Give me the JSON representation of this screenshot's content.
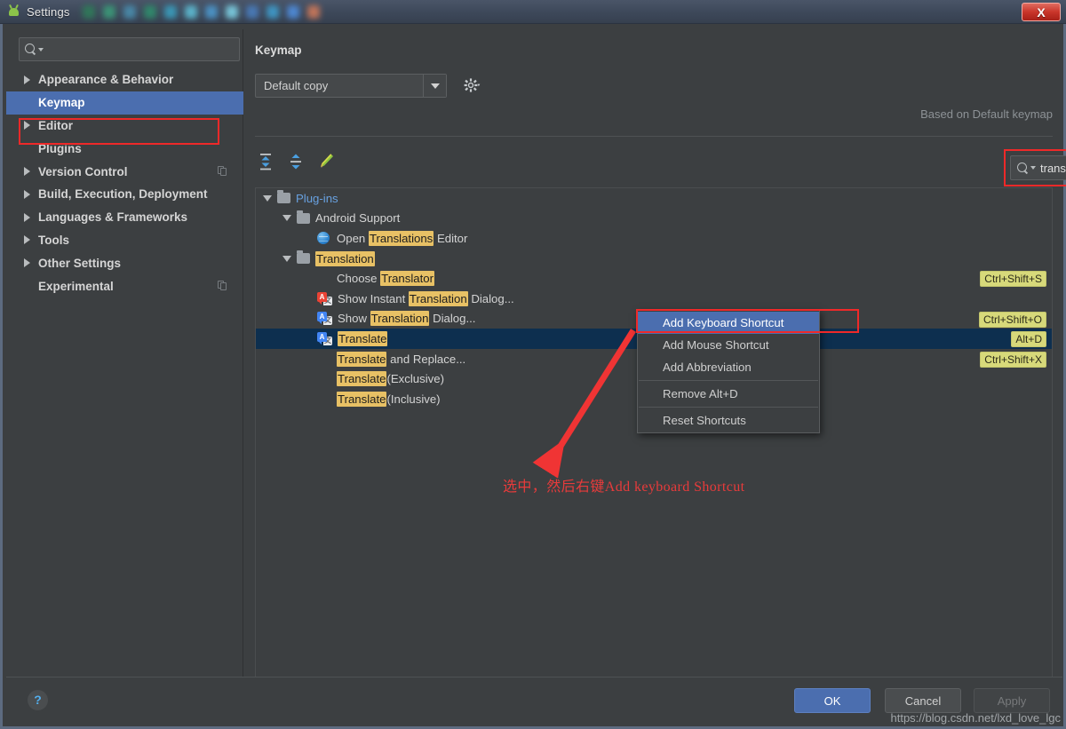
{
  "window": {
    "title": "Settings",
    "app_icon": "android-studio-icon",
    "close_label": "X",
    "taskbar_icon_colors": [
      "#2f7d5a",
      "#3b9d7a",
      "#4a8fb0",
      "#2f8f6d",
      "#3aa0c0",
      "#5fc0d8",
      "#4d9ad0",
      "#7fd4e8",
      "#4a7fc0",
      "#3f9fd0",
      "#4f8fe0",
      "#d07a5a"
    ]
  },
  "sidebar": {
    "search": {
      "value": "",
      "placeholder": ""
    },
    "items": [
      {
        "label": "Appearance & Behavior",
        "expandable": true,
        "selected": false,
        "badge": false
      },
      {
        "label": "Keymap",
        "expandable": false,
        "selected": true,
        "badge": false
      },
      {
        "label": "Editor",
        "expandable": true,
        "selected": false,
        "badge": false
      },
      {
        "label": "Plugins",
        "expandable": false,
        "selected": false,
        "badge": false
      },
      {
        "label": "Version Control",
        "expandable": true,
        "selected": false,
        "badge": true
      },
      {
        "label": "Build, Execution, Deployment",
        "expandable": true,
        "selected": false,
        "badge": false
      },
      {
        "label": "Languages & Frameworks",
        "expandable": true,
        "selected": false,
        "badge": false
      },
      {
        "label": "Tools",
        "expandable": true,
        "selected": false,
        "badge": false
      },
      {
        "label": "Other Settings",
        "expandable": true,
        "selected": false,
        "badge": false
      },
      {
        "label": "Experimental",
        "expandable": false,
        "selected": false,
        "badge": true
      }
    ]
  },
  "panel": {
    "title": "Keymap",
    "keymap_selected": "Default copy",
    "based_on": "Based on Default keymap",
    "toolbar": {
      "expand_all": "expand-all-icon",
      "collapse_all": "collapse-all-icon",
      "edit": "edit-pencil-icon"
    },
    "search": {
      "value": "translate",
      "placeholder": "",
      "clear_label": "×"
    },
    "find_by_shortcut": "find-by-shortcut-icon"
  },
  "tree": {
    "rows": [
      {
        "indent": 0,
        "twisty": "open",
        "icon": "folder",
        "segments": [
          {
            "t": "Plug-ins",
            "hl": false,
            "blue": true
          }
        ],
        "shortcut": "",
        "selected": false
      },
      {
        "indent": 1,
        "twisty": "open",
        "icon": "folder",
        "segments": [
          {
            "t": "Android Support",
            "hl": false
          }
        ],
        "shortcut": "",
        "selected": false
      },
      {
        "indent": 2,
        "twisty": "none",
        "icon": "globe",
        "segments": [
          {
            "t": "Open ",
            "hl": false
          },
          {
            "t": "Translations",
            "hl": true
          },
          {
            "t": " Editor",
            "hl": false
          }
        ],
        "shortcut": "",
        "selected": false
      },
      {
        "indent": 1,
        "twisty": "open",
        "icon": "folder",
        "segments": [
          {
            "t": "Translation",
            "hl": true
          }
        ],
        "shortcut": "",
        "selected": false
      },
      {
        "indent": 2,
        "twisty": "none",
        "icon": "none",
        "segments": [
          {
            "t": "Choose ",
            "hl": false
          },
          {
            "t": "Translator",
            "hl": true
          }
        ],
        "shortcut": "Ctrl+Shift+S",
        "selected": false
      },
      {
        "indent": 2,
        "twisty": "none",
        "icon": "trans-red",
        "segments": [
          {
            "t": "Show Instant ",
            "hl": false
          },
          {
            "t": "Translation",
            "hl": true
          },
          {
            "t": " Dialog...",
            "hl": false
          }
        ],
        "shortcut": "",
        "selected": false
      },
      {
        "indent": 2,
        "twisty": "none",
        "icon": "trans-blue",
        "segments": [
          {
            "t": "Show ",
            "hl": false
          },
          {
            "t": "Translation",
            "hl": true
          },
          {
            "t": " Dialog...",
            "hl": false
          }
        ],
        "shortcut": "Ctrl+Shift+O",
        "selected": false
      },
      {
        "indent": 2,
        "twisty": "none",
        "icon": "trans-blue",
        "segments": [
          {
            "t": "Translate",
            "hl": true
          }
        ],
        "shortcut": "Alt+D",
        "selected": true
      },
      {
        "indent": 2,
        "twisty": "none",
        "icon": "none",
        "segments": [
          {
            "t": "Translate",
            "hl": true
          },
          {
            "t": " and Replace...",
            "hl": false
          }
        ],
        "shortcut": "Ctrl+Shift+X",
        "selected": false
      },
      {
        "indent": 2,
        "twisty": "none",
        "icon": "none",
        "segments": [
          {
            "t": "Translate",
            "hl": true
          },
          {
            "t": "(Exclusive)",
            "hl": false
          }
        ],
        "shortcut": "",
        "selected": false
      },
      {
        "indent": 2,
        "twisty": "none",
        "icon": "none",
        "segments": [
          {
            "t": "Translate",
            "hl": true
          },
          {
            "t": "(Inclusive)",
            "hl": false
          }
        ],
        "shortcut": "",
        "selected": false
      }
    ]
  },
  "context_menu": {
    "items": [
      {
        "label": "Add Keyboard Shortcut",
        "highlighted": true,
        "separator_after": false
      },
      {
        "label": "Add Mouse Shortcut",
        "highlighted": false,
        "separator_after": false
      },
      {
        "label": "Add Abbreviation",
        "highlighted": false,
        "separator_after": true
      },
      {
        "label": "Remove Alt+D",
        "highlighted": false,
        "separator_after": true
      },
      {
        "label": "Reset Shortcuts",
        "highlighted": false,
        "separator_after": false
      }
    ]
  },
  "annotation": {
    "text": "选中，然后右键Add keyboard Shortcut",
    "color": "#e83b3b"
  },
  "footer": {
    "help": "?",
    "ok": "OK",
    "cancel": "Cancel",
    "apply": "Apply"
  },
  "watermark": "https://blog.csdn.net/lxd_love_lgc"
}
